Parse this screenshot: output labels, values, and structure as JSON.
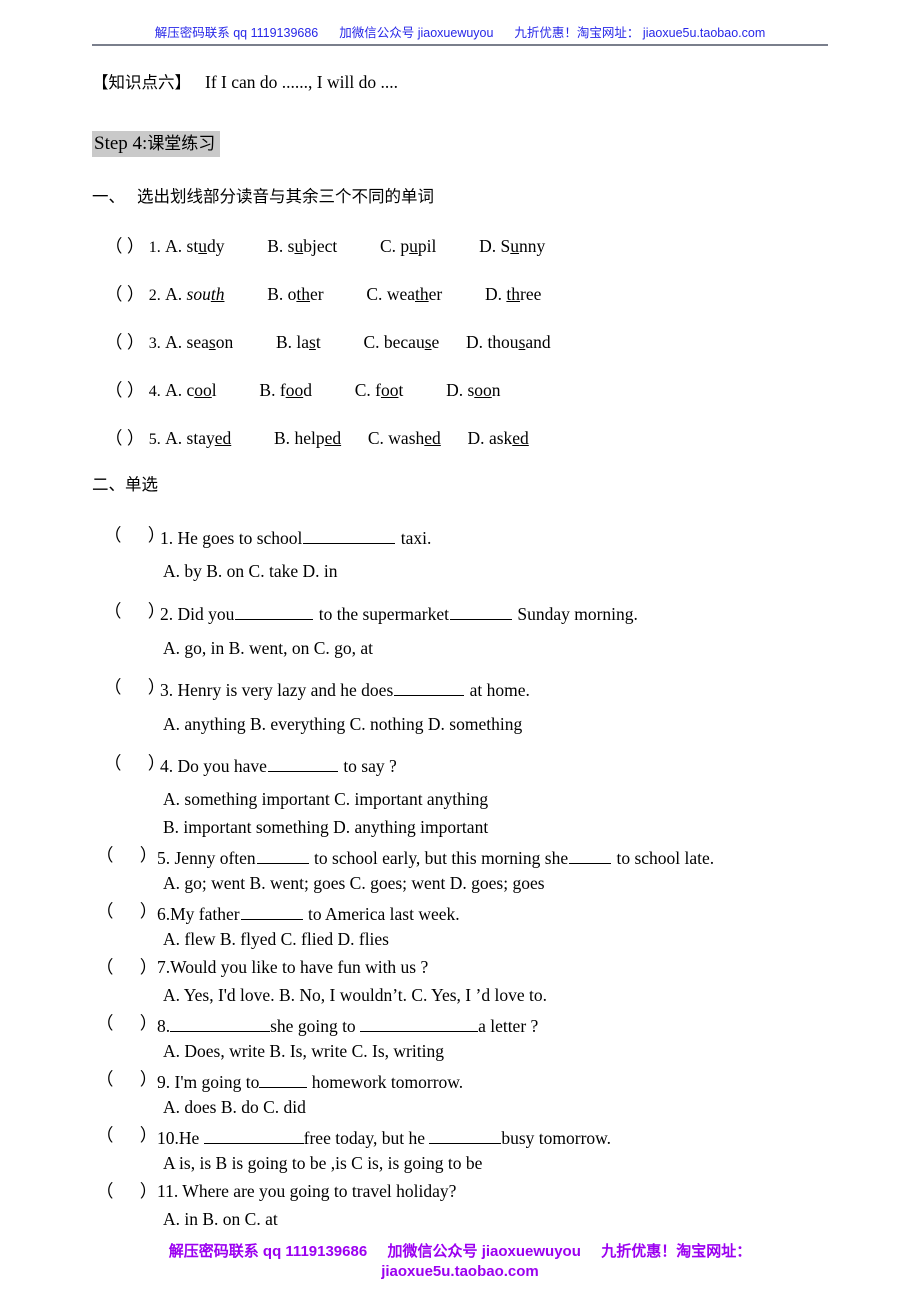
{
  "header": {
    "promo_part1": "解压密码联系 qq 1119139686",
    "promo_part2": "加微信公众号 jiaoxuewuyou",
    "promo_part3": "九折优惠！淘宝网址：",
    "promo_part4": "jiaoxue5u.taobao.com",
    "text_color": "#2727e8",
    "rule_color": "#7a7f8c"
  },
  "knowledge_point": {
    "tag": "【知识点六】",
    "text": "If I can do ......, I will do ...."
  },
  "step_heading": {
    "en": "Step 4:",
    "cn": "课堂练习",
    "highlight_color": "#c9c9c9"
  },
  "section_one": {
    "number": "一、",
    "title": "选出划线部分读音与其余三个不同的单词",
    "rows": [
      {
        "bracket": "（  ）",
        "num": "1.",
        "options": [
          {
            "label": "A.",
            "pre": "st",
            "mid": "u",
            "post": "dy",
            "italic": false
          },
          {
            "label": "B.",
            "pre": "s",
            "mid": "u",
            "post": "bject",
            "italic": false
          },
          {
            "label": "C.",
            "pre": "p",
            "mid": "u",
            "post": "pil",
            "italic": false
          },
          {
            "label": "D.",
            "pre": "S",
            "mid": "u",
            "post": "nny",
            "italic": false
          }
        ]
      },
      {
        "bracket": "（  ）",
        "num": "2.",
        "options": [
          {
            "label": "A.",
            "pre": "sou",
            "mid": "th",
            "post": "",
            "italic": true
          },
          {
            "label": "B.",
            "pre": "o",
            "mid": "th",
            "post": "er",
            "italic": false
          },
          {
            "label": "C.",
            "pre": "wea",
            "mid": "th",
            "post": "er",
            "italic": false
          },
          {
            "label": "D.",
            "pre": "",
            "mid": "th",
            "post": "ree",
            "italic": false
          }
        ]
      },
      {
        "bracket": "（  ）",
        "num": "3.",
        "options": [
          {
            "label": "A.",
            "pre": "sea",
            "mid": "s",
            "post": "on",
            "italic": false
          },
          {
            "label": "B.",
            "pre": "la",
            "mid": "s",
            "post": "t",
            "italic": false
          },
          {
            "label": "C.",
            "pre": "becau",
            "mid": "s",
            "post": "e",
            "italic": false
          },
          {
            "label": "D.",
            "pre": "thou",
            "mid": "s",
            "post": "and",
            "italic": false
          }
        ]
      },
      {
        "bracket": "（  ）",
        "num": "4.",
        "options": [
          {
            "label": "A.",
            "pre": "c",
            "mid": "oo",
            "post": "l",
            "italic": false
          },
          {
            "label": "B.",
            "pre": "f",
            "mid": "oo",
            "post": "d",
            "italic": false
          },
          {
            "label": "C.",
            "pre": "f",
            "mid": "oo",
            "post": "t",
            "italic": false
          },
          {
            "label": "D.",
            "pre": "s",
            "mid": "oo",
            "post": "n",
            "italic": false
          }
        ]
      },
      {
        "bracket": "（  ）",
        "num": "5.",
        "options": [
          {
            "label": "A.",
            "pre": "stay",
            "mid": "ed",
            "post": "",
            "italic": false
          },
          {
            "label": "B.",
            "pre": "help",
            "mid": "ed ",
            "post": "",
            "italic": false
          },
          {
            "label": "C.",
            "pre": "wash",
            "mid": "ed ",
            "post": "",
            "italic": false
          },
          {
            "label": "D.",
            "pre": "ask",
            "mid": "ed",
            "post": "",
            "italic": false
          }
        ]
      }
    ]
  },
  "section_two": {
    "number": "二、",
    "title": "单选",
    "questions": [
      {
        "bracket_open": "（",
        "bracket_close": "）",
        "num": "1.",
        "stem_a": "He goes to school",
        "stem_b": "taxi.",
        "options": "A. by        B. on        C. take    D. in"
      },
      {
        "num": "2.",
        "stem_a": "Did you",
        "stem_b": "to the supermarket",
        "stem_c": "Sunday morning.",
        "options": "A. go, in     B. went, on       C. go, at"
      },
      {
        "num": "3.",
        "stem_a": "Henry is very lazy and he does",
        "stem_b": "at home.",
        "options": "A. anything B. everything C. nothing D. something"
      },
      {
        "num": "4.",
        "stem_a": "Do you have",
        "stem_b": "to say ?",
        "options_line1": "A. something important         C. important anything",
        "options_line2": "B. important something         D. anything important"
      },
      {
        "num": "5.",
        "stem_a": "Jenny often",
        "stem_b": "to school early, but this morning she",
        "stem_c": "to school late.",
        "options": "A. go; went        B. went; goes      C. goes; went       D. goes; goes"
      },
      {
        "num": "6.",
        "stem_a": "My father",
        "stem_b": "to America last week.",
        "options": "A. flew      B. flyed     C. flied     D. flies"
      },
      {
        "num": "7.",
        "stem_a": "Would you like to have fun with us ?",
        "options": "A. Yes, I'd love.            B. No, I wouldn’t.      C. Yes, I ’d love to."
      },
      {
        "num": "8.",
        "stem_a": "",
        "stem_b": "she going to",
        "stem_c": "a letter ?",
        "options": "A. Does, write        B. Is, write        C. Is, writing"
      },
      {
        "num": "9.",
        "stem_a": "I'm going to",
        "stem_b": "homework tomorrow.",
        "options": "A. does      B. do      C. did"
      },
      {
        "num": "10.",
        "stem_a": "He",
        "stem_b": "free today, but he",
        "stem_c": "busy tomorrow.",
        "options": "A    is, is          B is going to be ,is          C is, is going to be"
      },
      {
        "num": "11.",
        "stem_a": "Where are you going to travel holiday?",
        "options": "A. in            B. on        C. at"
      }
    ]
  },
  "footer": {
    "line1_part1": "解压密码联系 qq 1119139686",
    "line1_part2": "加微信公众号 jiaoxuewuyou",
    "line1_part3": "九折优惠！淘宝网址：",
    "line2": "jiaoxue5u.taobao.com",
    "text_color": "#9b00f0"
  }
}
